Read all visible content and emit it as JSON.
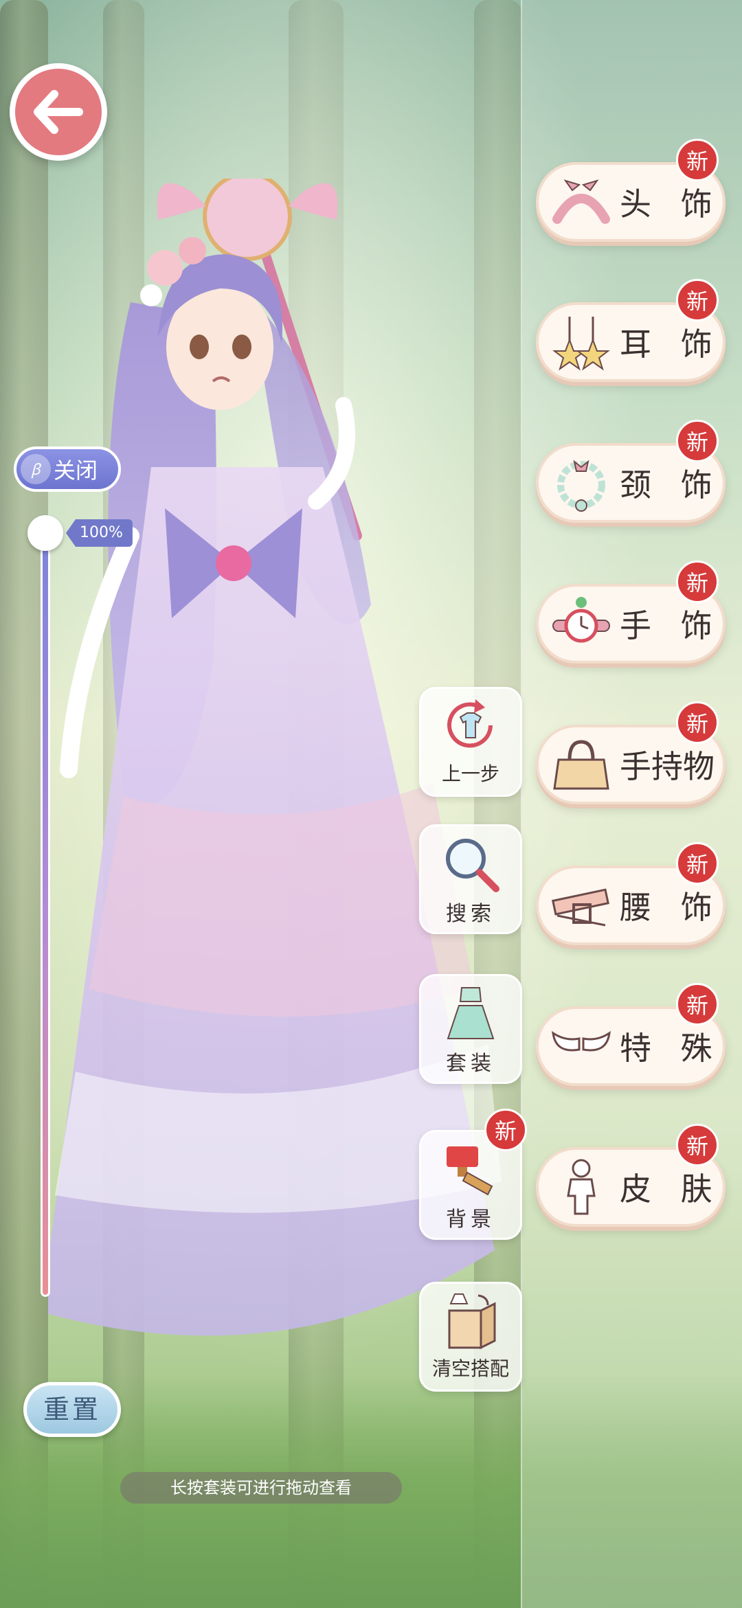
{
  "toggle": {
    "label": "关闭"
  },
  "zoom": {
    "percent_label": "100%",
    "value": 1.0
  },
  "reset": {
    "label": "重置"
  },
  "categories": [
    {
      "label": "头 饰",
      "badge": "新",
      "icon": "headband-icon"
    },
    {
      "label": "耳 饰",
      "badge": "新",
      "icon": "star-earrings-icon"
    },
    {
      "label": "颈 饰",
      "badge": "新",
      "icon": "necklace-icon"
    },
    {
      "label": "手 饰",
      "badge": "新",
      "icon": "wrist-watch-icon"
    },
    {
      "label": "手持物",
      "badge": "新",
      "icon": "handbag-icon"
    },
    {
      "label": "腰 饰",
      "badge": "新",
      "icon": "belt-icon"
    },
    {
      "label": "特 殊",
      "badge": "新",
      "icon": "wings-icon"
    },
    {
      "label": "皮 肤",
      "badge": "新",
      "icon": "doll-body-icon"
    }
  ],
  "tools": {
    "undo": {
      "label": "上一步",
      "icon": "undo-shirt-icon"
    },
    "search": {
      "label": "搜索",
      "icon": "magnifier-icon"
    },
    "outfit": {
      "label": "套装",
      "icon": "dress-icon"
    },
    "background": {
      "label": "背景",
      "badge": "新",
      "icon": "paint-brush-icon"
    },
    "clear": {
      "label": "清空搭配",
      "icon": "box-icon"
    }
  },
  "hint": {
    "text": "长按套装可进行拖动查看"
  },
  "colors": {
    "back_button": "#e37a80",
    "badge": "#d63a3a",
    "toggle": "#7178c9",
    "reset": "#9dc8e0"
  }
}
